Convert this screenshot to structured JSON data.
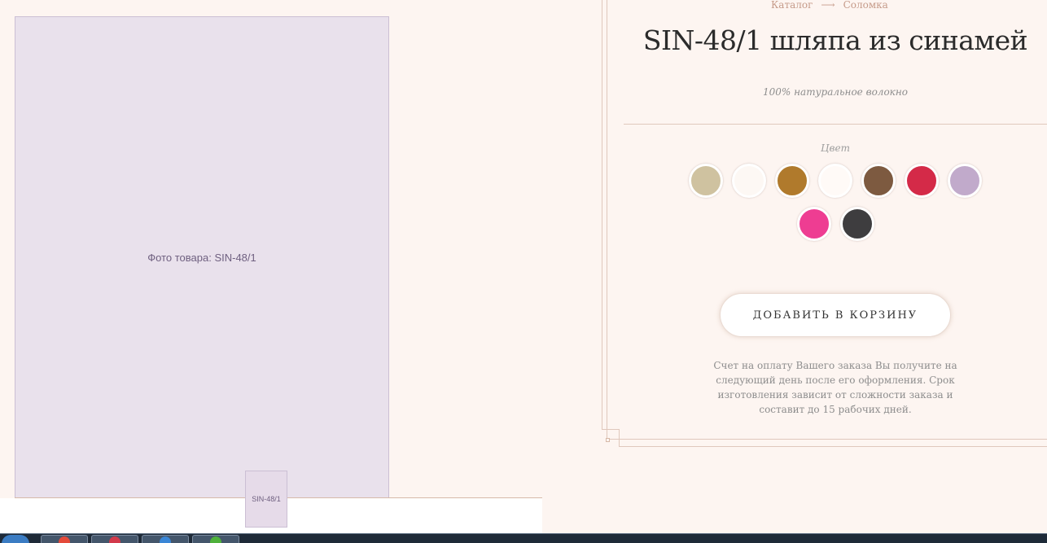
{
  "breadcrumb": {
    "catalog": "Каталог",
    "arrow": "⟶",
    "category": "Соломка"
  },
  "product": {
    "title": "SIN-48/1 шляпа из синамей",
    "material": "100% натуральное волокно",
    "image_label": "Фото товара: SIN-48/1",
    "thumb_label": "SIN-48/1"
  },
  "colors": {
    "label": "Цвет",
    "swatches": [
      "#cfc2a0",
      "#fdf8f4",
      "#b07a2c",
      "#fffaf7",
      "#7d5a40",
      "#d42a48",
      "#c1aacb",
      "#ee3d92",
      "#3e3d3f"
    ]
  },
  "cart": {
    "button_label": "ДОБАВИТЬ В КОРЗИНУ"
  },
  "note": "Счет на оплату Вашего заказа Вы получите на следующий день после его оформления. Срок изготовления зависит от сложности заказа и составит до 15 рабочих дней.",
  "taskbar": {
    "buttons": [
      {
        "icon": "chrome-icon",
        "color": "#e44a3a"
      },
      {
        "icon": "opera-icon",
        "color": "#d23a4b"
      },
      {
        "icon": "internet-explorer-icon",
        "color": "#3a86d6"
      },
      {
        "icon": "green-app-icon",
        "color": "#4fb13b"
      }
    ]
  }
}
